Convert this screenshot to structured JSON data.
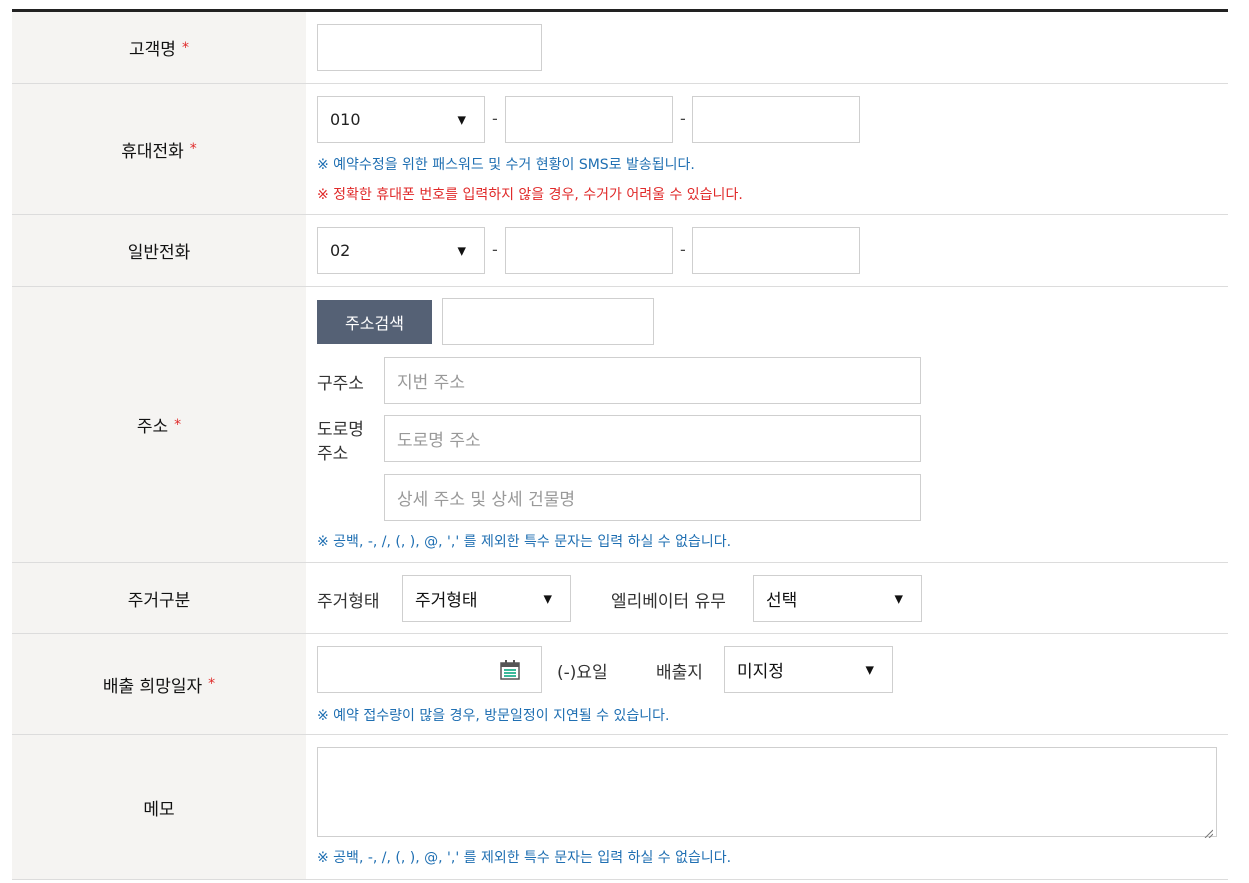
{
  "rows": {
    "name": {
      "label": "고객명",
      "required": "*"
    },
    "mobile": {
      "label": "휴대전화",
      "required": "*",
      "prefix": "010",
      "dash": "-",
      "note1": "※ 예약수정을 위한 패스워드 및 수거 현황이 SMS로 발송됩니다.",
      "note2": "※ 정확한 휴대폰 번호를 입력하지 않을 경우, 수거가 어려울 수 있습니다."
    },
    "phone": {
      "label": "일반전화",
      "prefix": "02",
      "dash": "-"
    },
    "address": {
      "label": "주소",
      "required": "*",
      "search_button": "주소검색",
      "old_label": "구주소",
      "old_placeholder": "지번 주소",
      "road_label_1": "도로명",
      "road_label_2": "주소",
      "road_placeholder": "도로명 주소",
      "detail_placeholder": "상세 주소 및 상세 건물명",
      "note": "※ 공백, -, /, (, ), @, ',' 를 제외한 특수 문자는 입력 하실 수 없습니다."
    },
    "housing": {
      "label": "주거구분",
      "type_label": "주거형태",
      "type_value": "주거형태",
      "elevator_label": "엘리베이터 유무",
      "elevator_value": "선택"
    },
    "date": {
      "label": "배출 희망일자",
      "required": "*",
      "weekday": "(-)요일",
      "place_label": "배출지",
      "place_value": "미지정",
      "note": "※ 예약 접수량이 많을 경우, 방문일정이 지연될 수 있습니다."
    },
    "memo": {
      "label": "메모",
      "note": "※ 공백, -, /, (, ), @, ',' 를 제외한 특수 문자는 입력 하실 수 없습니다."
    }
  },
  "icons": {
    "dropdown": "triangle-down-icon",
    "calendar": "calendar-icon",
    "resize": "resize-handle-icon"
  },
  "colors": {
    "button_bg": "#556175",
    "note_blue": "#1f6fb2",
    "note_red": "#e02a2a",
    "label_bg": "#f5f4f2"
  }
}
